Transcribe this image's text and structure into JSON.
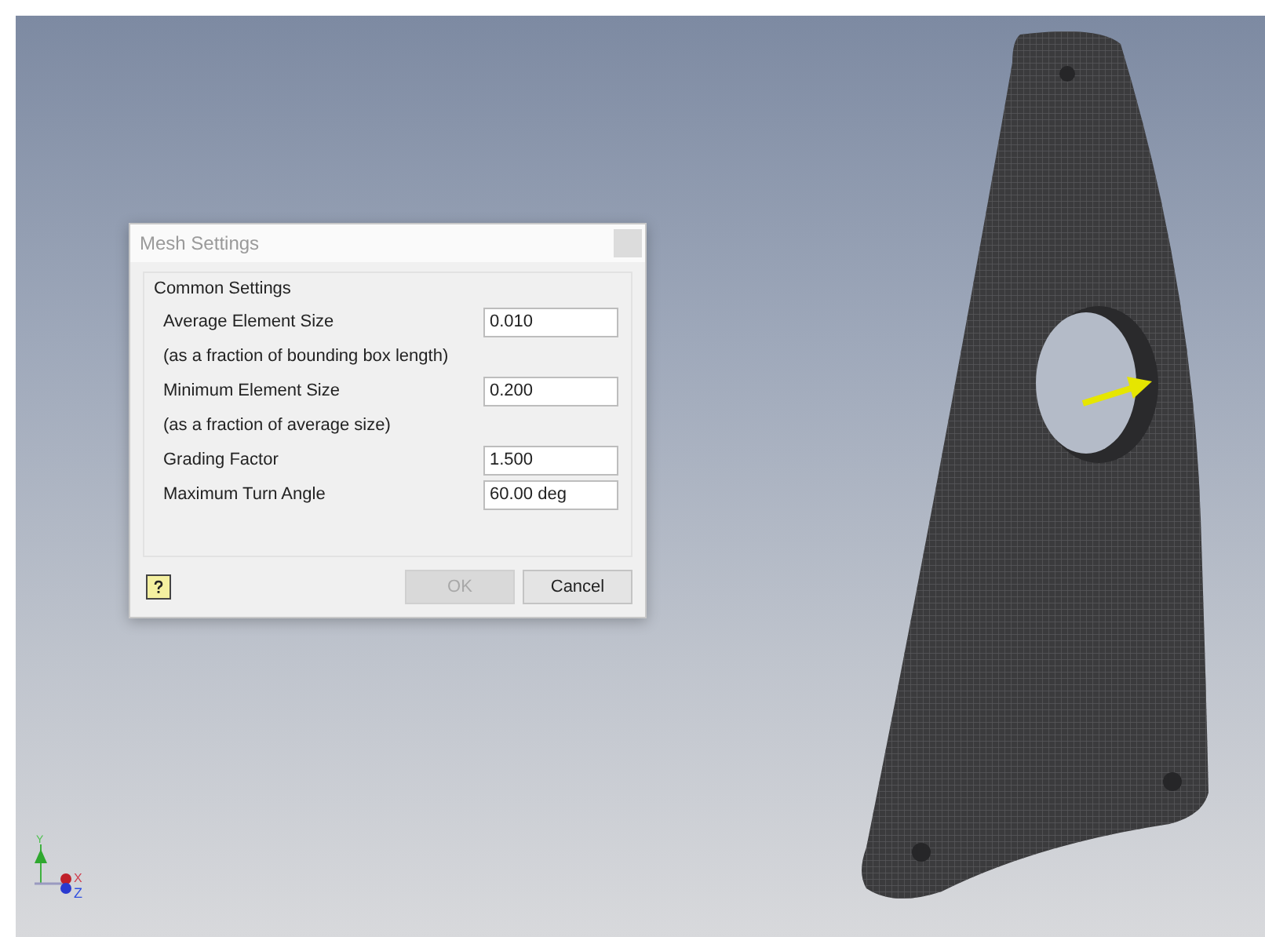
{
  "dialog": {
    "title": "Mesh Settings",
    "group": {
      "title": "Common Settings",
      "rows": [
        {
          "kind": "field",
          "label": "Average Element Size",
          "value": "0.010"
        },
        {
          "kind": "note",
          "label": "(as a fraction of bounding box length)"
        },
        {
          "kind": "field",
          "label": "Minimum Element Size",
          "value": "0.200"
        },
        {
          "kind": "note",
          "label": "(as a fraction of average size)"
        },
        {
          "kind": "field",
          "label": "Grading Factor",
          "value": "1.500"
        },
        {
          "kind": "field",
          "label": "Maximum Turn Angle",
          "value": "60.00 deg"
        }
      ]
    },
    "buttons": [
      {
        "label": "OK",
        "disabled": true
      },
      {
        "label": "Cancel",
        "disabled": false
      }
    ]
  },
  "axes": {
    "x": "X",
    "y": "Y",
    "z": "Z"
  }
}
